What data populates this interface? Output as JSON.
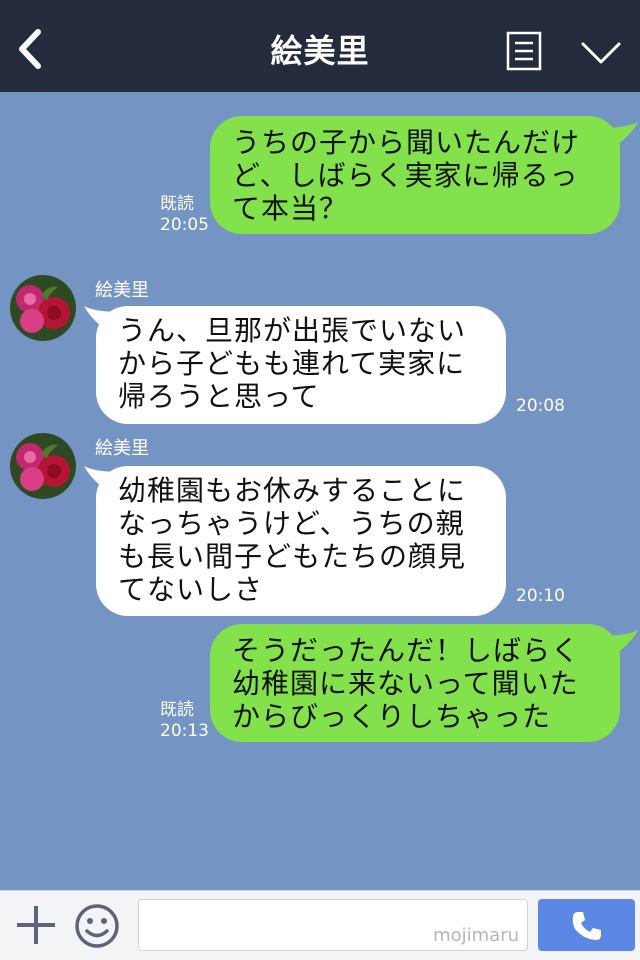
{
  "header": {
    "title": "絵美里",
    "back_icon": "chevron-left-icon",
    "menu_icon": "note-icon",
    "expand_icon": "chevron-down-icon"
  },
  "messages": [
    {
      "direction": "out",
      "lines": [
        "うちの子から聞いたんだけ",
        "ど、しばらく実家に帰るっ",
        "て本当？"
      ],
      "read": "既読",
      "time": "20:05"
    },
    {
      "direction": "in",
      "sender": "絵美里",
      "lines": [
        "うん、旦那が出張でいない",
        "から子どもも連れて実家に",
        "帰ろうと思って"
      ],
      "time": "20:08"
    },
    {
      "direction": "in",
      "sender": "絵美里",
      "lines": [
        "幼稚園もお休みすることに",
        "なっちゃうけど、うちの親",
        "も長い間子どもたちの顔見",
        "てないしさ"
      ],
      "time": "20:10"
    },
    {
      "direction": "out",
      "lines": [
        "そうだったんだ！しばらく",
        "幼稚園に来ないって聞いた",
        "からびっくりしちゃった"
      ],
      "read": "既読",
      "time": "20:13"
    }
  ],
  "footer": {
    "watermark": "mojimaru",
    "plus_icon": "plus-icon",
    "sticker_icon": "smile-icon",
    "call_icon": "phone-icon"
  },
  "colors": {
    "background": "#7494c3",
    "header": "#232b3d",
    "outgoing_bubble": "#83e24b",
    "incoming_bubble": "#ffffff",
    "call_button": "#5d87e4"
  }
}
